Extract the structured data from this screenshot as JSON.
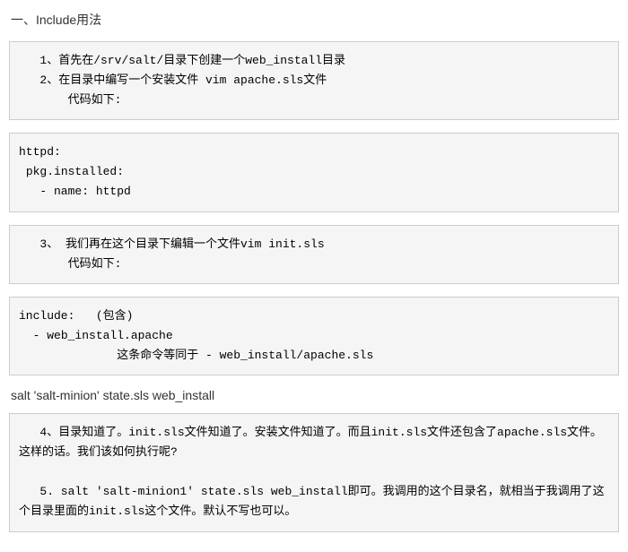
{
  "heading": "一、Include用法",
  "block1": "   1、首先在/srv/salt/目录下创建一个web_install目录\n   2、在目录中编写一个安装文件 vim apache.sls文件\n       代码如下:",
  "block2": "httpd:\n pkg.installed:\n   - name: httpd",
  "block3": "   3、 我们再在这个目录下编辑一个文件vim init.sls\n       代码如下:",
  "block4": "include:   (包含)\n  - web_install.apache\n              这条命令等同于 - web_install/apache.sls",
  "cmdline": "salt 'salt-minion' state.sls web_install",
  "block5": "   4、目录知道了。init.sls文件知道了。安装文件知道了。而且init.sls文件还包含了apache.sls文件。这样的话。我们该如何执行呢?\n\n   5. salt 'salt-minion1' state.sls web_install即可。我调用的这个目录名，就相当于我调用了这个目录里面的init.sls这个文件。默认不写也可以。"
}
